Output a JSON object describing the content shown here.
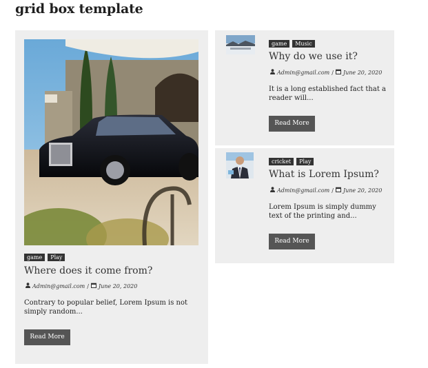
{
  "page": {
    "title": "grid box template"
  },
  "featured_post": {
    "tags": [
      "game",
      "Play"
    ],
    "title": "Where does it come from?",
    "author": "Admin@gmail.com",
    "date": "June 20, 2020",
    "excerpt": "Contrary to popular belief, Lorem Ipsum is not simply random...",
    "button_label": "Read More",
    "image_icon": "car-photo"
  },
  "side_posts": [
    {
      "tags": [
        "game",
        "Music"
      ],
      "title": "Why do we use it?",
      "author": "Admin@gmail.com",
      "date": "June 20, 2020",
      "excerpt": "It is a long established fact that a reader will...",
      "button_label": "Read More",
      "image_icon": "snowy-landscape-thumbnail"
    },
    {
      "tags": [
        "cricket",
        "Play"
      ],
      "title": "What is Lorem Ipsum?",
      "author": "Admin@gmail.com",
      "date": "June 20, 2020",
      "excerpt": "Lorem Ipsum is simply dummy text of the printing and...",
      "button_label": "Read More",
      "image_icon": "businessman-thumbnail"
    }
  ],
  "icons": {
    "author": "user-icon",
    "date": "calendar-icon"
  },
  "colors": {
    "card_bg": "#eeeeee",
    "tag_bg": "#333333",
    "button_bg": "#555555"
  }
}
